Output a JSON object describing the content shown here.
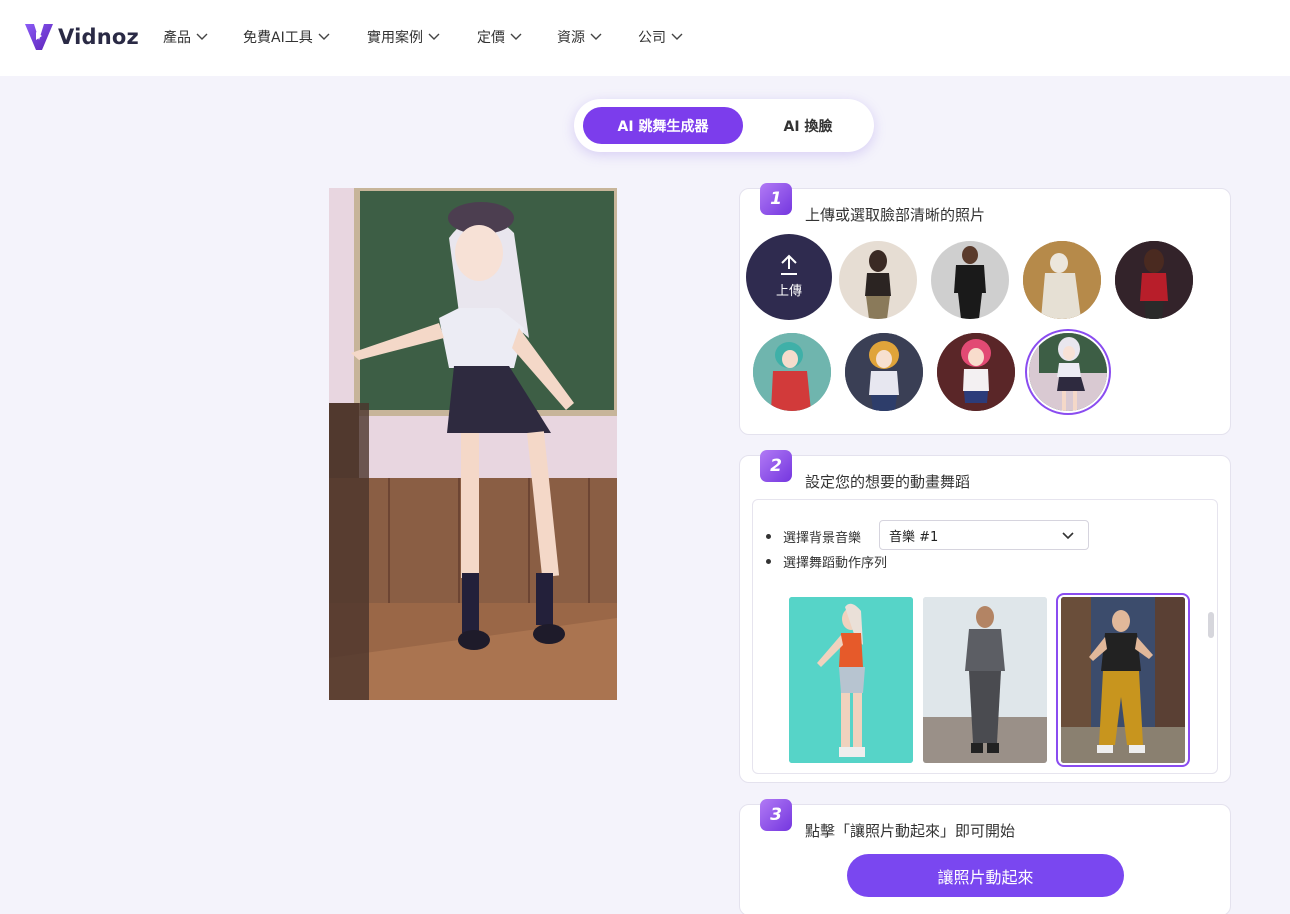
{
  "brand": {
    "name": "Vidnoz",
    "accent": "#7c3dec"
  },
  "nav": [
    {
      "label": "產品"
    },
    {
      "label": "免費AI工具"
    },
    {
      "label": "實用案例"
    },
    {
      "label": "定價"
    },
    {
      "label": "資源"
    },
    {
      "label": "公司"
    }
  ],
  "tabs": {
    "dance": "AI 跳舞生成器",
    "swap": "AI 換臉"
  },
  "step1": {
    "number": "1",
    "title": "上傳或選取臉部清晰的照片",
    "upload_label": "上傳",
    "samples": [
      "woman-photo",
      "man-black-suit",
      "statue",
      "woman-red-dress",
      "anime-green-hair",
      "anime-blonde",
      "anime-pink-hair",
      "anime-white-hair"
    ],
    "selected": "anime-white-hair"
  },
  "step2": {
    "number": "2",
    "title": "設定您的想要的動畫舞蹈",
    "music_label": "選擇背景音樂",
    "music_value": "音樂 #1",
    "dance_label": "選擇舞蹈動作序列",
    "dances": [
      "dance-orange-top",
      "dance-grey-shirt",
      "dance-yellow-pants"
    ],
    "selected": "dance-yellow-pants"
  },
  "step3": {
    "number": "3",
    "title": "點擊「讓照片動起來」即可開始",
    "button": "讓照片動起來"
  }
}
